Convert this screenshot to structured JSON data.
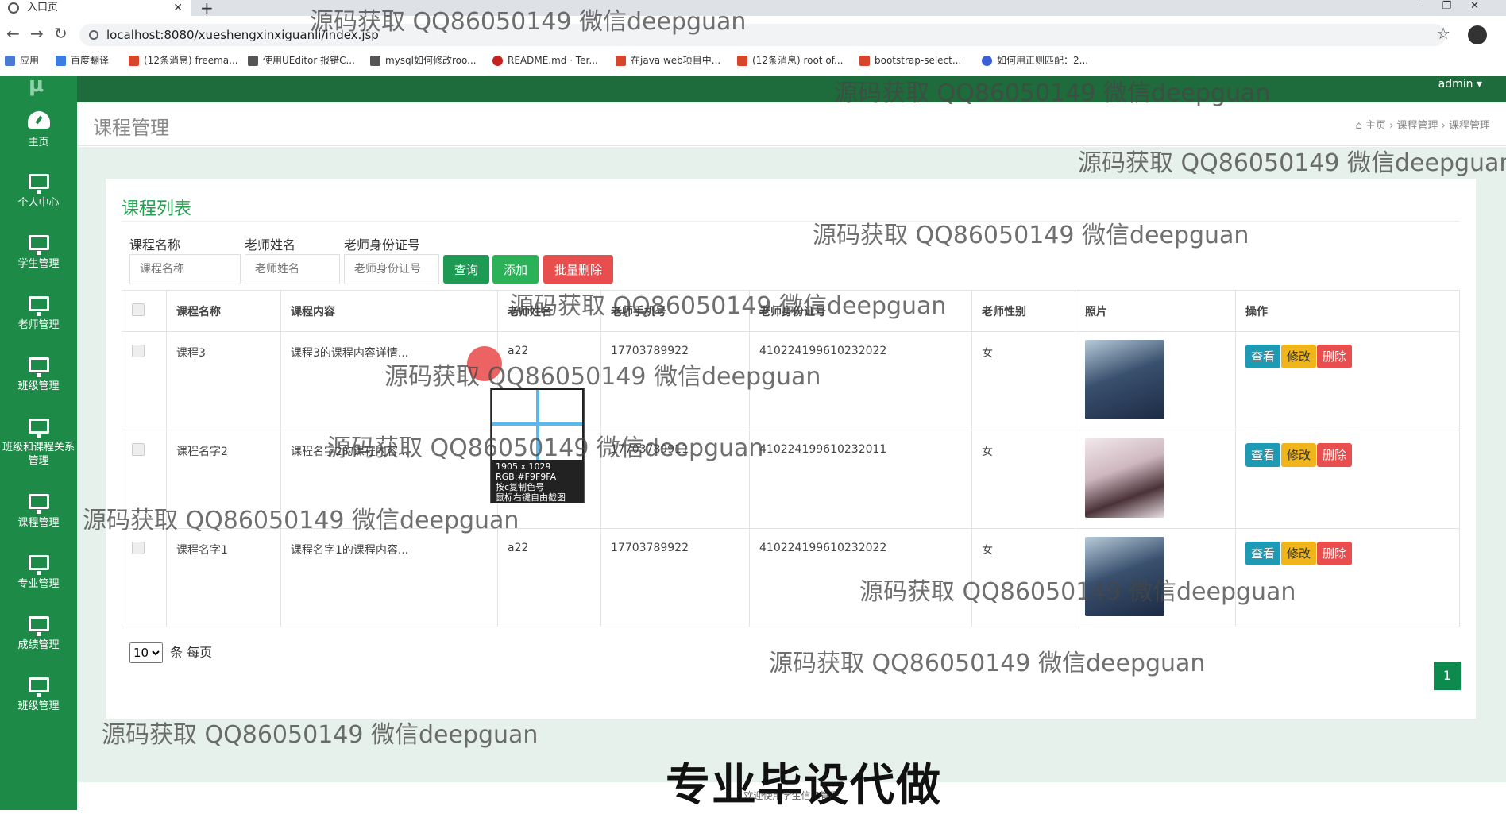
{
  "browser": {
    "tab_title": "入口页",
    "url": "localhost:8080/xueshengxinxiguanli/index.jsp",
    "bookmarks": [
      "应用",
      "百度翻译",
      "(12条消息) freema...",
      "使用UEditor 报错C...",
      "mysql如何修改roo...",
      "README.md · Ter...",
      "在java web项目中...",
      "(12条消息) root of...",
      "bootstrap-select...",
      "如何用正则匹配：2..."
    ]
  },
  "topbar": {
    "user": "admin ▾"
  },
  "sidebar": {
    "items": [
      {
        "label": "主页",
        "icon": "dashboard-icon"
      },
      {
        "label": "个人中心",
        "icon": "monitor-icon"
      },
      {
        "label": "学生管理",
        "icon": "monitor-icon"
      },
      {
        "label": "老师管理",
        "icon": "monitor-icon"
      },
      {
        "label": "班级管理",
        "icon": "monitor-icon"
      },
      {
        "label": "班级和课程关系管理",
        "icon": "monitor-icon"
      },
      {
        "label": "课程管理",
        "icon": "monitor-icon"
      },
      {
        "label": "专业管理",
        "icon": "monitor-icon"
      },
      {
        "label": "成绩管理",
        "icon": "monitor-icon"
      },
      {
        "label": "班级管理",
        "icon": "monitor-icon"
      }
    ]
  },
  "page": {
    "title": "课程管理",
    "breadcrumb": [
      "主页",
      "课程管理",
      "课程管理"
    ]
  },
  "card": {
    "title": "课程列表"
  },
  "search": {
    "course_label": "课程名称",
    "course_placeholder": "课程名称",
    "teacher_label": "老师姓名",
    "teacher_placeholder": "老师姓名",
    "idcard_label": "老师身份证号",
    "idcard_placeholder": "老师身份证号",
    "query_btn": "查询",
    "add_btn": "添加",
    "batch_delete_btn": "批量删除"
  },
  "table": {
    "headers": [
      "课程名称",
      "课程内容",
      "老师姓名",
      "老师手机号",
      "老师身份证号",
      "老师性别",
      "照片",
      "操作"
    ],
    "rows": [
      {
        "name": "课程3",
        "content": "课程3的课程内容详情...",
        "teacher": "a22",
        "phone": "17703789922",
        "idcard": "410224199610232022",
        "gender": "女"
      },
      {
        "name": "课程名字2",
        "content": "课程名字2的课程内容...",
        "teacher": "",
        "phone": "17703789911",
        "idcard": "410224199610232011",
        "gender": "女"
      },
      {
        "name": "课程名字1",
        "content": "课程名字1的课程内容...",
        "teacher": "a22",
        "phone": "17703789922",
        "idcard": "410224199610232022",
        "gender": "女"
      }
    ],
    "actions": {
      "view": "查看",
      "edit": "修改",
      "delete": "删除"
    }
  },
  "pager": {
    "per_page": "10",
    "per_page_suffix": "条 每页",
    "current_page": "1"
  },
  "overlay": {
    "picker_text": "1905 x 1029\nRGB:#F9F9FA\n按c复制色号\n鼠标右键自由截图",
    "watermark": "源码获取 QQ86050149 微信deepguan",
    "banner": "专业毕设代做",
    "footer": "欢迎使用学生信息管理"
  },
  "colors": {
    "sidebar": "#1e8a48",
    "topbar": "#1e6b3b",
    "accent": "#24a150"
  }
}
